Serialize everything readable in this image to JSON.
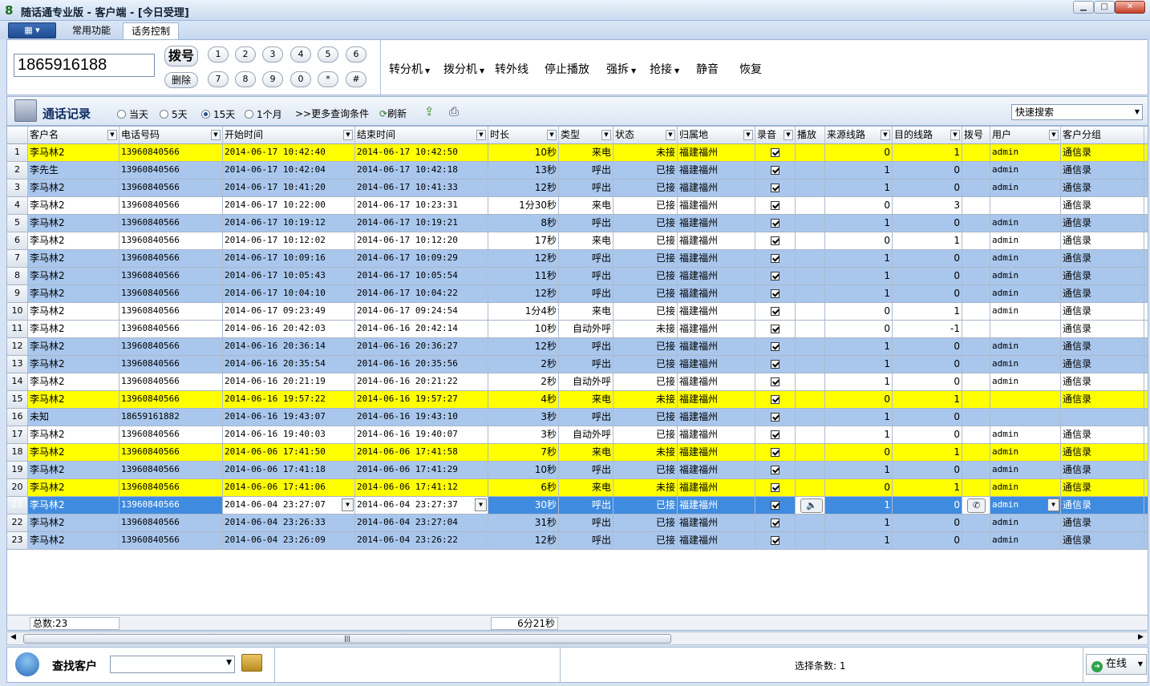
{
  "window": {
    "title": "随话通专业版 - 客户端 - [今日受理]"
  },
  "tabs": [
    "常用功能",
    "话务控制"
  ],
  "dial": {
    "number": "1865916188",
    "dial_label": "拨号",
    "delete_label": "删除",
    "keys": [
      "1",
      "2",
      "3",
      "4",
      "5",
      "6",
      "7",
      "8",
      "9",
      "0",
      "*",
      "#"
    ],
    "actions": [
      {
        "label": "转分机",
        "dropdown": true
      },
      {
        "label": "拨分机",
        "dropdown": true
      },
      {
        "label": "转外线",
        "dropdown": false
      },
      {
        "label": "停止播放",
        "dropdown": false
      },
      {
        "label": "强拆",
        "dropdown": true
      },
      {
        "label": "抢接",
        "dropdown": true
      },
      {
        "label": "静音",
        "dropdown": false
      },
      {
        "label": "恢复",
        "dropdown": false
      }
    ]
  },
  "log": {
    "title": "通话记录",
    "ranges": [
      "当天",
      "5天",
      "15天",
      "1个月"
    ],
    "selected_range": "15天",
    "more_filters": ">>更多查询条件",
    "refresh": "刷新",
    "quick_search": "快速搜索"
  },
  "columns": [
    "客户名",
    "电话号码",
    "开始时间",
    "结束时间",
    "时长",
    "类型",
    "状态",
    "归属地",
    "录音",
    "播放",
    "来源线路",
    "目的线路",
    "拨号",
    "用户",
    "客户分组"
  ],
  "rows": [
    {
      "n": "1",
      "name": "李马林2",
      "phone": "13960840566",
      "start": "2014-06-17 10:42:40",
      "end": "2014-06-17 10:42:50",
      "dur": "10秒",
      "type": "来电",
      "status": "未接",
      "loc": "福建福州",
      "src": "0",
      "dst": "1",
      "user": "admin",
      "group": "通信录",
      "style": "y"
    },
    {
      "n": "2",
      "name": "李先生",
      "phone": "13960840566",
      "start": "2014-06-17 10:42:04",
      "end": "2014-06-17 10:42:18",
      "dur": "13秒",
      "type": "呼出",
      "status": "已接",
      "loc": "福建福州",
      "src": "1",
      "dst": "0",
      "user": "admin",
      "group": "通信录",
      "style": "b"
    },
    {
      "n": "3",
      "name": "李马林2",
      "phone": "13960840566",
      "start": "2014-06-17 10:41:20",
      "end": "2014-06-17 10:41:33",
      "dur": "12秒",
      "type": "呼出",
      "status": "已接",
      "loc": "福建福州",
      "src": "1",
      "dst": "0",
      "user": "admin",
      "group": "通信录",
      "style": "b"
    },
    {
      "n": "4",
      "name": "李马林2",
      "phone": "13960840566",
      "start": "2014-06-17 10:22:00",
      "end": "2014-06-17 10:23:31",
      "dur": "1分30秒",
      "type": "来电",
      "status": "已接",
      "loc": "福建福州",
      "src": "0",
      "dst": "3",
      "user": "",
      "group": "通信录",
      "style": "w"
    },
    {
      "n": "5",
      "name": "李马林2",
      "phone": "13960840566",
      "start": "2014-06-17 10:19:12",
      "end": "2014-06-17 10:19:21",
      "dur": "8秒",
      "type": "呼出",
      "status": "已接",
      "loc": "福建福州",
      "src": "1",
      "dst": "0",
      "user": "admin",
      "group": "通信录",
      "style": "b"
    },
    {
      "n": "6",
      "name": "李马林2",
      "phone": "13960840566",
      "start": "2014-06-17 10:12:02",
      "end": "2014-06-17 10:12:20",
      "dur": "17秒",
      "type": "来电",
      "status": "已接",
      "loc": "福建福州",
      "src": "0",
      "dst": "1",
      "user": "admin",
      "group": "通信录",
      "style": "w"
    },
    {
      "n": "7",
      "name": "李马林2",
      "phone": "13960840566",
      "start": "2014-06-17 10:09:16",
      "end": "2014-06-17 10:09:29",
      "dur": "12秒",
      "type": "呼出",
      "status": "已接",
      "loc": "福建福州",
      "src": "1",
      "dst": "0",
      "user": "admin",
      "group": "通信录",
      "style": "b"
    },
    {
      "n": "8",
      "name": "李马林2",
      "phone": "13960840566",
      "start": "2014-06-17 10:05:43",
      "end": "2014-06-17 10:05:54",
      "dur": "11秒",
      "type": "呼出",
      "status": "已接",
      "loc": "福建福州",
      "src": "1",
      "dst": "0",
      "user": "admin",
      "group": "通信录",
      "style": "b"
    },
    {
      "n": "9",
      "name": "李马林2",
      "phone": "13960840566",
      "start": "2014-06-17 10:04:10",
      "end": "2014-06-17 10:04:22",
      "dur": "12秒",
      "type": "呼出",
      "status": "已接",
      "loc": "福建福州",
      "src": "1",
      "dst": "0",
      "user": "admin",
      "group": "通信录",
      "style": "b"
    },
    {
      "n": "10",
      "name": "李马林2",
      "phone": "13960840566",
      "start": "2014-06-17 09:23:49",
      "end": "2014-06-17 09:24:54",
      "dur": "1分4秒",
      "type": "来电",
      "status": "已接",
      "loc": "福建福州",
      "src": "0",
      "dst": "1",
      "user": "admin",
      "group": "通信录",
      "style": "w"
    },
    {
      "n": "11",
      "name": "李马林2",
      "phone": "13960840566",
      "start": "2014-06-16 20:42:03",
      "end": "2014-06-16 20:42:14",
      "dur": "10秒",
      "type": "自动外呼",
      "status": "未接",
      "loc": "福建福州",
      "src": "0",
      "dst": "-1",
      "user": "",
      "group": "通信录",
      "style": "w"
    },
    {
      "n": "12",
      "name": "李马林2",
      "phone": "13960840566",
      "start": "2014-06-16 20:36:14",
      "end": "2014-06-16 20:36:27",
      "dur": "12秒",
      "type": "呼出",
      "status": "已接",
      "loc": "福建福州",
      "src": "1",
      "dst": "0",
      "user": "admin",
      "group": "通信录",
      "style": "b"
    },
    {
      "n": "13",
      "name": "李马林2",
      "phone": "13960840566",
      "start": "2014-06-16 20:35:54",
      "end": "2014-06-16 20:35:56",
      "dur": "2秒",
      "type": "呼出",
      "status": "已接",
      "loc": "福建福州",
      "src": "1",
      "dst": "0",
      "user": "admin",
      "group": "通信录",
      "style": "b"
    },
    {
      "n": "14",
      "name": "李马林2",
      "phone": "13960840566",
      "start": "2014-06-16 20:21:19",
      "end": "2014-06-16 20:21:22",
      "dur": "2秒",
      "type": "自动外呼",
      "status": "已接",
      "loc": "福建福州",
      "src": "1",
      "dst": "0",
      "user": "admin",
      "group": "通信录",
      "style": "w"
    },
    {
      "n": "15",
      "name": "李马林2",
      "phone": "13960840566",
      "start": "2014-06-16 19:57:22",
      "end": "2014-06-16 19:57:27",
      "dur": "4秒",
      "type": "来电",
      "status": "未接",
      "loc": "福建福州",
      "src": "0",
      "dst": "1",
      "user": "",
      "group": "通信录",
      "style": "y"
    },
    {
      "n": "16",
      "name": "未知",
      "phone": "18659161882",
      "start": "2014-06-16 19:43:07",
      "end": "2014-06-16 19:43:10",
      "dur": "3秒",
      "type": "呼出",
      "status": "已接",
      "loc": "福建福州",
      "src": "1",
      "dst": "0",
      "user": "",
      "group": "",
      "style": "b"
    },
    {
      "n": "17",
      "name": "李马林2",
      "phone": "13960840566",
      "start": "2014-06-16 19:40:03",
      "end": "2014-06-16 19:40:07",
      "dur": "3秒",
      "type": "自动外呼",
      "status": "已接",
      "loc": "福建福州",
      "src": "1",
      "dst": "0",
      "user": "admin",
      "group": "通信录",
      "style": "w"
    },
    {
      "n": "18",
      "name": "李马林2",
      "phone": "13960840566",
      "start": "2014-06-06 17:41:50",
      "end": "2014-06-06 17:41:58",
      "dur": "7秒",
      "type": "来电",
      "status": "未接",
      "loc": "福建福州",
      "src": "0",
      "dst": "1",
      "user": "admin",
      "group": "通信录",
      "style": "y"
    },
    {
      "n": "19",
      "name": "李马林2",
      "phone": "13960840566",
      "start": "2014-06-06 17:41:18",
      "end": "2014-06-06 17:41:29",
      "dur": "10秒",
      "type": "呼出",
      "status": "已接",
      "loc": "福建福州",
      "src": "1",
      "dst": "0",
      "user": "admin",
      "group": "通信录",
      "style": "b"
    },
    {
      "n": "20",
      "name": "李马林2",
      "phone": "13960840566",
      "start": "2014-06-06 17:41:06",
      "end": "2014-06-06 17:41:12",
      "dur": "6秒",
      "type": "来电",
      "status": "未接",
      "loc": "福建福州",
      "src": "0",
      "dst": "1",
      "user": "admin",
      "group": "通信录",
      "style": "y"
    },
    {
      "n": "21",
      "name": "李马林2",
      "phone": "13960840566",
      "start": "2014-06-04 23:27:07",
      "end": "2014-06-04 23:27:37",
      "dur": "30秒",
      "type": "呼出",
      "status": "已接",
      "loc": "福建福州",
      "src": "1",
      "dst": "0",
      "user": "admin",
      "group": "通信录",
      "style": "sel"
    },
    {
      "n": "22",
      "name": "李马林2",
      "phone": "13960840566",
      "start": "2014-06-04 23:26:33",
      "end": "2014-06-04 23:27:04",
      "dur": "31秒",
      "type": "呼出",
      "status": "已接",
      "loc": "福建福州",
      "src": "1",
      "dst": "0",
      "user": "admin",
      "group": "通信录",
      "style": "b"
    },
    {
      "n": "23",
      "name": "李马林2",
      "phone": "13960840566",
      "start": "2014-06-04 23:26:09",
      "end": "2014-06-04 23:26:22",
      "dur": "12秒",
      "type": "呼出",
      "status": "已接",
      "loc": "福建福州",
      "src": "1",
      "dst": "0",
      "user": "admin",
      "group": "通信录",
      "style": "b"
    }
  ],
  "footer": {
    "total": "总数:23",
    "duration_total": "6分21秒"
  },
  "status": {
    "find_label": "查找客户",
    "selected": "选择条数: 1",
    "online": "在线"
  },
  "colors": {
    "unanswered_row": "#ffff00",
    "answered_row": "#a9c7ed",
    "selected_row": "#3f8be0"
  }
}
